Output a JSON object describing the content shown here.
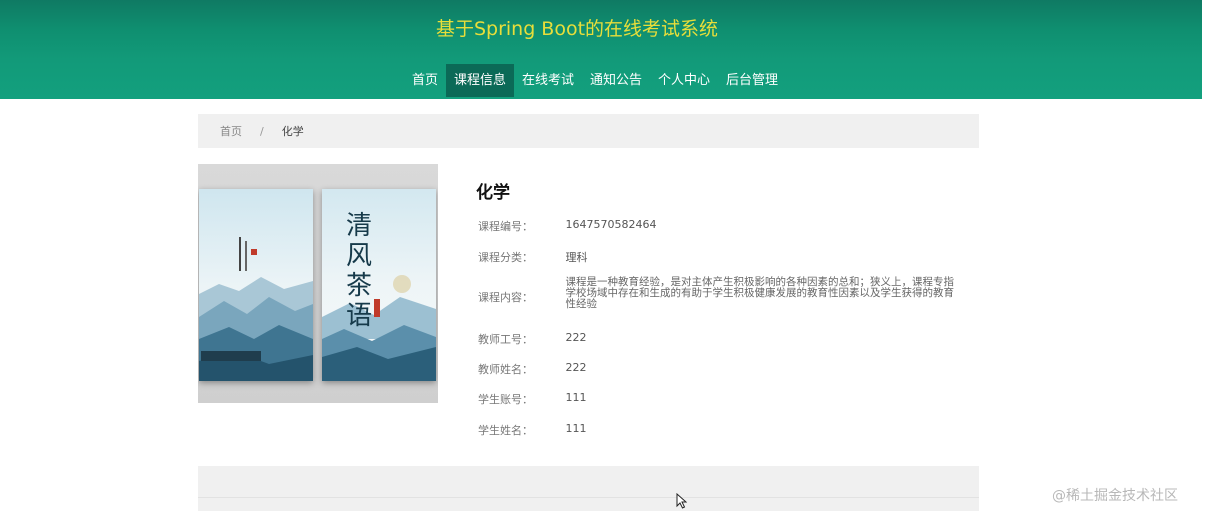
{
  "header": {
    "title": "基于Spring Boot的在线考试系统"
  },
  "nav": {
    "items": [
      {
        "label": "首页",
        "active": false
      },
      {
        "label": "课程信息",
        "active": true
      },
      {
        "label": "在线考试",
        "active": false
      },
      {
        "label": "通知公告",
        "active": false
      },
      {
        "label": "个人中心",
        "active": false
      },
      {
        "label": "后台管理",
        "active": false
      }
    ]
  },
  "breadcrumb": {
    "home": "首页",
    "separator": "/",
    "current": "化学"
  },
  "cover": {
    "book_title": "清风茶语"
  },
  "detail": {
    "title": "化学",
    "fields": [
      {
        "label": "课程编号：",
        "value": "1647570582464"
      },
      {
        "label": "课程分类：",
        "value": "理科"
      },
      {
        "label": "课程内容：",
        "value": "课程是一种教育经验，是对主体产生积极影响的各种因素的总和；狭义上，课程专指学校场域中存在和生成的有助于学生积极健康发展的教育性因素以及学生获得的教育性经验"
      },
      {
        "label": "教师工号：",
        "value": "222"
      },
      {
        "label": "教师姓名：",
        "value": "222"
      },
      {
        "label": "学生账号：",
        "value": "111"
      },
      {
        "label": "学生姓名：",
        "value": "111"
      }
    ]
  },
  "watermark": "@稀土掘金技术社区",
  "colors": {
    "header_bg": "#13a07e",
    "header_title": "#e8de3a",
    "nav_active_bg": "#0b6a57",
    "panel_bg": "#f0f0f0"
  }
}
